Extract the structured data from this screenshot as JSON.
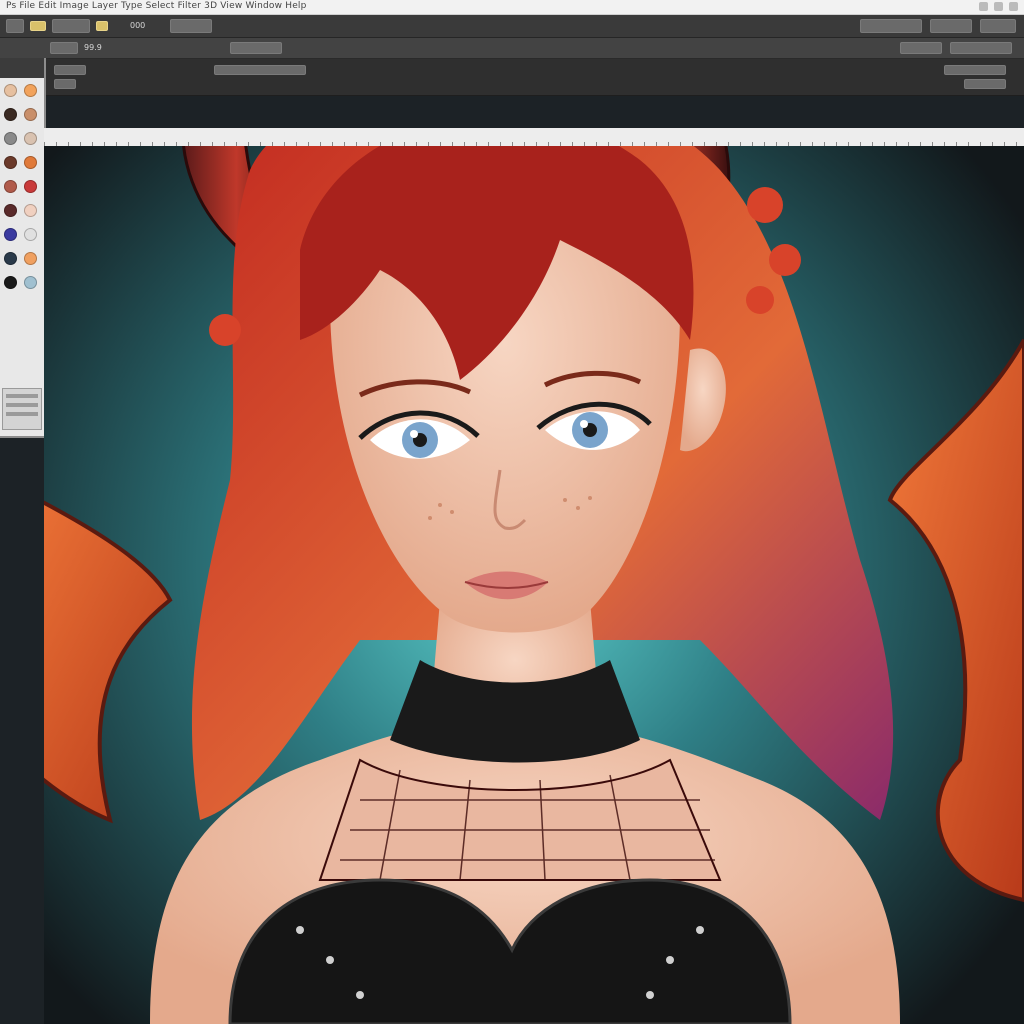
{
  "window": {
    "title": "Ps File Edit Image Layer Type Select Filter 3D View Window Help"
  },
  "toolbar": {
    "zoom_label": "000",
    "layer_label": "99.9"
  },
  "panels": {
    "swatches": [
      {
        "color": "#e6c0a0"
      },
      {
        "color": "#f2a35c"
      },
      {
        "color": "#3a2a22"
      },
      {
        "color": "#c98f6a"
      },
      {
        "color": "#8a8a8a"
      },
      {
        "color": "#d9c2b0"
      },
      {
        "color": "#6b3a2a"
      },
      {
        "color": "#e07a3a"
      },
      {
        "color": "#b05a4a"
      },
      {
        "color": "#c93a3a"
      },
      {
        "color": "#5a2a2a"
      },
      {
        "color": "#f0d0c0"
      },
      {
        "color": "#3a3aa0"
      },
      {
        "color": "#e0e0e0"
      },
      {
        "color": "#2a3a4a"
      },
      {
        "color": "#f0a060"
      },
      {
        "color": "#1a1a1a"
      },
      {
        "color": "#a0c0d0"
      }
    ]
  },
  "canvas": {
    "subject": "illustration",
    "palette": {
      "background_dark": "#1a2226",
      "background_teal": "#4fb7b7",
      "hair_red": "#b3241d",
      "hair_orange": "#e8663a",
      "skin": "#f1c9b3",
      "wing": "#e0532b",
      "outfit": "#1a1a1a",
      "eyes": "#7aa4cc"
    }
  }
}
